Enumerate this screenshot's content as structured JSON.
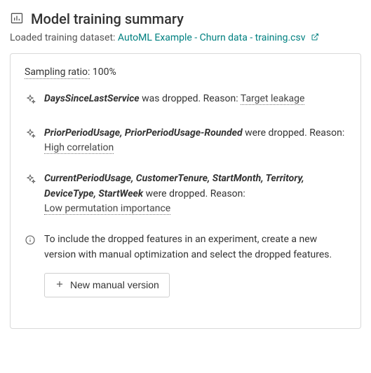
{
  "header": {
    "title": "Model training summary",
    "subtitle_prefix": "Loaded training dataset:",
    "dataset_name": "AutoML Example - Churn data - training.csv"
  },
  "card": {
    "sampling_label": "Sampling ratio:",
    "sampling_value": "100%",
    "dropped": [
      {
        "features": "DaysSinceLastService",
        "verb": "was dropped. Reason:",
        "reason": "Target leakage"
      },
      {
        "features": "PriorPeriodUsage, PriorPeriodUsage-Rounded",
        "verb": "were dropped. Reason:",
        "reason": "High correlation"
      },
      {
        "features": "CurrentPeriodUsage, CustomerTenure, StartMonth, Territory, DeviceType, StartWeek",
        "verb": "were dropped. Reason:",
        "reason": "Low permutation importance"
      }
    ],
    "info_text": "To include the dropped features in an experiment, create a new version with manual optimization and select the dropped features.",
    "button_label": "New manual version"
  }
}
